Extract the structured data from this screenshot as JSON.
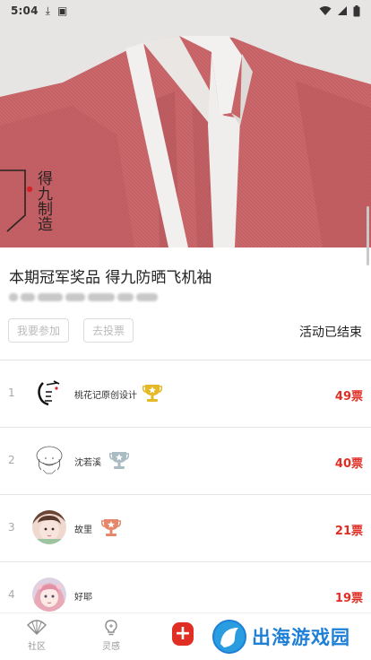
{
  "status_bar": {
    "time": "5:04"
  },
  "hero": {
    "seal_text": "得九制造"
  },
  "title": "本期冠军奖品 得九防晒飞机袖",
  "actions": {
    "join_label": "我要参加",
    "vote_label": "去投票"
  },
  "activity_status": "活动已结束",
  "ranking": [
    {
      "rank": "1",
      "name": "桃花记原创设计",
      "votes": "49票",
      "trophy": "gold"
    },
    {
      "rank": "2",
      "name": "沈若溪",
      "votes": "40票",
      "trophy": "silver"
    },
    {
      "rank": "3",
      "name": "故里",
      "votes": "21票",
      "trophy": "bronze"
    },
    {
      "rank": "4",
      "name": "好耶",
      "votes": "19票",
      "trophy": "none"
    }
  ],
  "bottom_nav": {
    "items": [
      {
        "label": "社区",
        "icon": "fan-icon"
      },
      {
        "label": "灵感",
        "icon": "lightbulb-icon"
      }
    ],
    "add_label": "+"
  },
  "watermark": {
    "text": "出海游戏园"
  },
  "colors": {
    "accent_red": "#e02e24",
    "gold": "#e5b825",
    "silver": "#a9bcc4",
    "bronze": "#e5876b",
    "fabric": "#c8666a",
    "watermark_blue": "#1e7fd6"
  }
}
